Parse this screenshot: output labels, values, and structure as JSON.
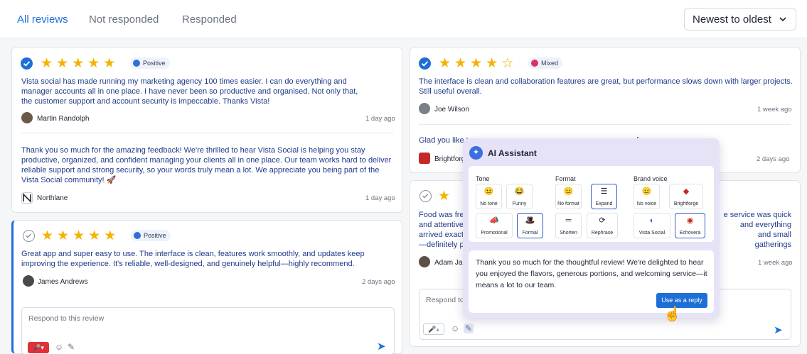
{
  "tabs": [
    {
      "label": "All reviews",
      "active": true
    },
    {
      "label": "Not responded"
    },
    {
      "label": "Responded"
    }
  ],
  "sort": {
    "label": "Newest to oldest",
    "icon": "chevron-down-icon"
  },
  "reviews": [
    {
      "rating": 5,
      "sentiment": "Positive",
      "text": "Vista social has made running my marketing agency 100 times easier. I can do everything and manager accounts all in one place. I have never been so productive and organised. Not only that, the customer support and account security is impeccable. Thanks Vista!",
      "author": "Martin Randolph",
      "time": "1 day ago",
      "reply": {
        "text": "Thank you so much for the amazing feedback! We're thrilled to hear Vista Social is helping you stay productive, organized, and confident managing your clients all in one place. Our team works hard to deliver reliable support and strong security, so your words truly mean a lot. We appreciate you being part of the Vista Social community! 🚀",
        "author": "Northlane",
        "time": "1 day ago"
      }
    },
    {
      "rating": 5,
      "sentiment": "Positive",
      "text": "Great app and super easy to use. The interface is clean, features work smoothly, and updates keep improving the experience. It's reliable, well-designed, and genuinely helpful—highly recommend.",
      "author": "James Andrews",
      "time": "2 days ago",
      "reply_placeholder": "Respond to this review"
    },
    {
      "rating": 4,
      "sentiment": "Mixed",
      "text": "The interface is clean and collaboration features are great, but performance slows down with larger projects. Still useful overall.",
      "author": "Joe Wilson",
      "time": "1 week ago",
      "reply": {
        "text_visible": "Glad you like t",
        "text_visible_tail": "f",
        "author": "Brightforg",
        "time": "2 days ago"
      }
    },
    {
      "rating": 5,
      "lines_left": [
        "Food was fres",
        "and attentive",
        "arrived exact",
        "—definitely p"
      ],
      "lines_right": [
        "e service was quick",
        "and everything",
        "and small gatherings"
      ],
      "author": "Adam Jam",
      "time": "1 week ago",
      "reply_placeholder": "Respond to"
    }
  ],
  "ai_assistant": {
    "title": "AI Assistant",
    "groups": [
      {
        "label": "Tone",
        "options": [
          {
            "label": "No tone",
            "icon": "😐",
            "selected": false
          },
          {
            "label": "Funny",
            "icon": "😂",
            "selected": false
          },
          {
            "label": "Promotional",
            "icon": "📣",
            "selected": false
          },
          {
            "label": "Formal",
            "icon": "🎩",
            "selected": true
          }
        ]
      },
      {
        "label": "Format",
        "options": [
          {
            "label": "No format",
            "icon": "😐",
            "selected": false
          },
          {
            "label": "Expand",
            "icon": "☰",
            "selected": true
          },
          {
            "label": "Shorten",
            "icon": "═",
            "selected": false
          },
          {
            "label": "Rephrase",
            "icon": "⟳",
            "selected": false
          }
        ]
      },
      {
        "label": "Brand voice",
        "options": [
          {
            "label": "No voice",
            "icon": "😐",
            "selected": false
          },
          {
            "label": "Brightforge",
            "icon": "◆",
            "selected": false
          },
          {
            "label": "Vista Social",
            "icon": "◐",
            "selected": false
          },
          {
            "label": "Echovera",
            "icon": "◉",
            "selected": true
          }
        ]
      }
    ],
    "generated_reply": "Thank you so much for the thoughtful review! We're delighted to hear you enjoyed the flavors, generous portions, and welcoming service—it means a lot to our team.",
    "use_button": "Use as a reply"
  }
}
